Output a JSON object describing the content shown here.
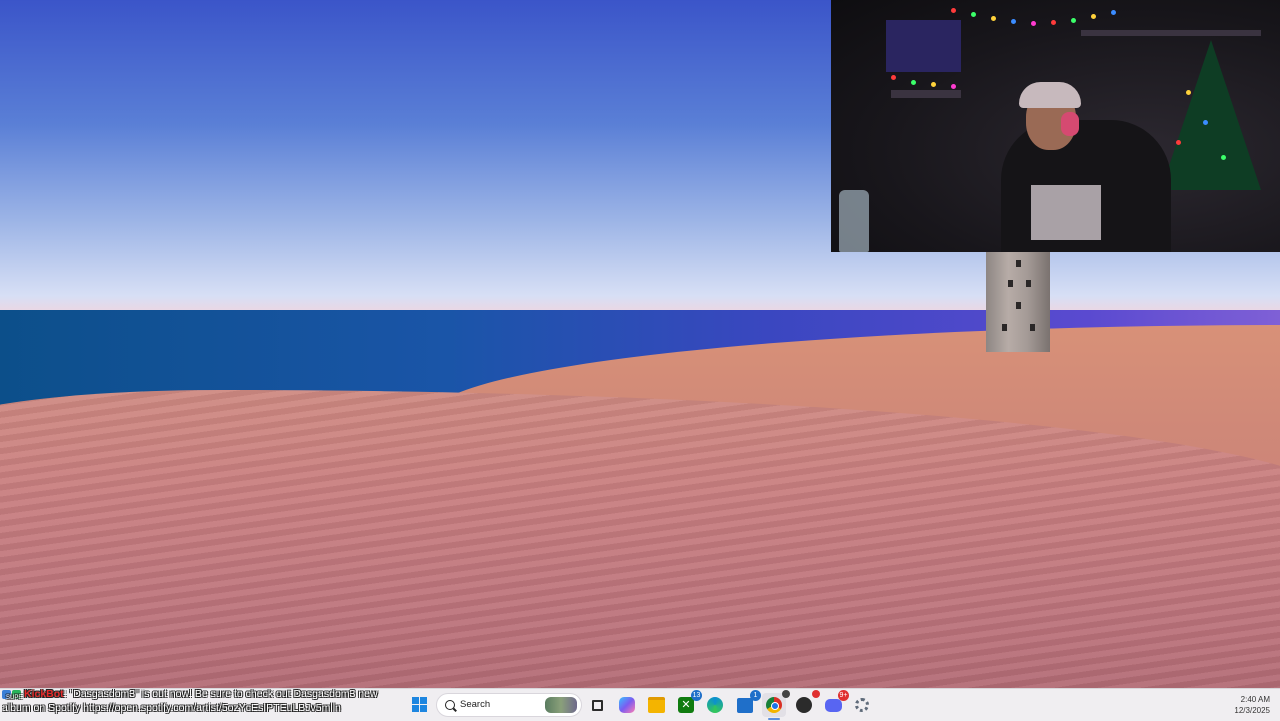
{
  "chat": {
    "bot_name": "KickBot",
    "sub_badge": "SUPE",
    "message_line1": ": \"Dasgasdom3\" is out now! Be sure to check out Dasgasdom3 new",
    "message_line2": "album on Spotify https://open.spotify.com/artist/5ozYcEsIPTEuLBJv5mlln"
  },
  "taskbar": {
    "search_label": "Search",
    "apps": [
      {
        "name": "task-view-icon",
        "color": "#2b2b2b"
      },
      {
        "name": "copilot-icon",
        "color": "#7b5cf0"
      },
      {
        "name": "file-explorer-icon",
        "color": "#f4b400"
      },
      {
        "name": "xbox-icon",
        "color": "#107c10",
        "badge": "13"
      },
      {
        "name": "edge-icon",
        "color": "#0b8fd1"
      },
      {
        "name": "microsoft-store-icon",
        "color": "#1f6fc9",
        "badge": "1"
      },
      {
        "name": "chrome-icon",
        "color": "#d93025"
      },
      {
        "name": "obs-icon",
        "color": "#2b2b2b"
      },
      {
        "name": "discord-icon",
        "color": "#5865f2",
        "badge": "9+"
      },
      {
        "name": "settings-icon",
        "color": "#5f6b7a"
      }
    ],
    "time": "2:40 AM",
    "date": "12/3/2025"
  }
}
